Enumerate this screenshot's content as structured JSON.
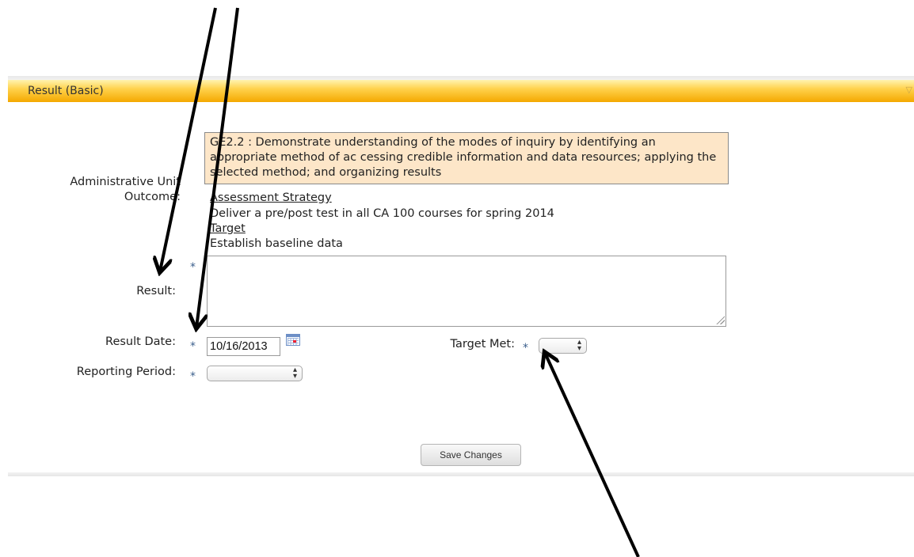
{
  "panel": {
    "title": "Result (Basic)"
  },
  "form": {
    "admin_unit_label": "Administrative Unit Outcome:",
    "outcome_text": "GE2.2 : Demonstrate understanding of the modes of inquiry by identifying an appropriate method of ac cessing credible information and data resources; applying the selected method; and organizing results",
    "assessment_strategy_heading": "Assessment Strategy",
    "assessment_strategy_text": "Deliver a pre/post test in all CA 100 courses for spring 2014",
    "target_heading": "Target",
    "target_text": "Establish baseline data",
    "result_label": "Result:",
    "result_value": "",
    "result_date_label": "Result Date:",
    "result_date_value": "10/16/2013",
    "target_met_label": "Target Met:",
    "target_met_value": "",
    "reporting_period_label": "Reporting Period:",
    "reporting_period_value": "",
    "required_marker": "*"
  },
  "buttons": {
    "save_label": "Save Changes"
  },
  "icons": {
    "calendar": "calendar-icon",
    "select_arrows": "updown-arrows-icon"
  },
  "colors": {
    "header_gold": "#f4a800",
    "outcome_bg": "#fde6c8",
    "required": "#3b5f8c"
  }
}
